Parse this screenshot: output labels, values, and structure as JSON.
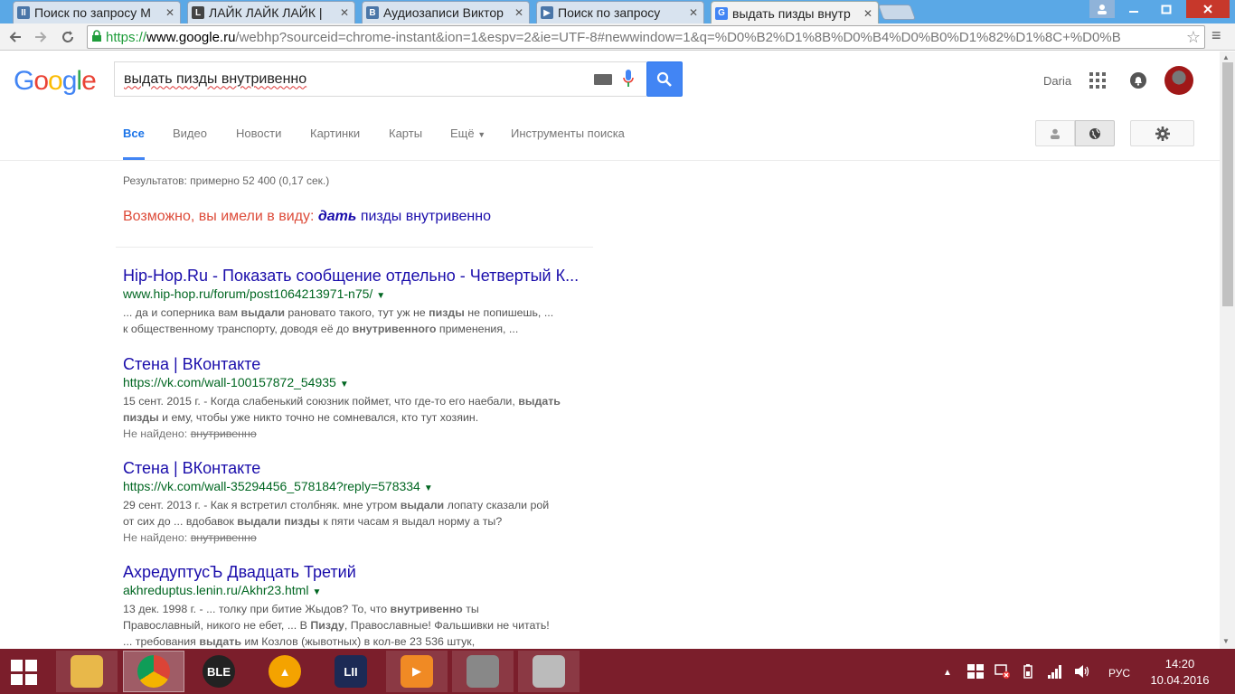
{
  "browser": {
    "tabs": [
      {
        "title": "Поиск по запросу М",
        "fav": "II",
        "fav_color": "#4a76a8"
      },
      {
        "title": "ЛАЙК ЛАЙК ЛАЙК |",
        "fav": "L",
        "fav_color": "#444444"
      },
      {
        "title": "Аудиозаписи Виктор",
        "fav": "B",
        "fav_color": "#4a76a8"
      },
      {
        "title": "Поиск по запросу",
        "fav": "▶",
        "fav_color": "#4a76a8"
      },
      {
        "title": "выдать пизды внутр",
        "fav": "G",
        "fav_color": "#4285f4"
      }
    ],
    "url_scheme": "https://",
    "url_host": "www.google.ru",
    "url_rest": "/webhp?sourceid=chrome-instant&ion=1&espv=2&ie=UTF-8#newwindow=1&q=%D0%B2%D1%8B%D0%B4%D0%B0%D1%82%D1%8C+%D0%B"
  },
  "google": {
    "logo": "Google",
    "query": "выдать пизды внутривенно",
    "user_name": "Daria",
    "nav_tabs": [
      "Все",
      "Видео",
      "Новости",
      "Картинки",
      "Карты",
      "Ещё",
      "Инструменты поиска"
    ],
    "stats": "Результатов: примерно 52 400 (0,17 сек.)",
    "spell_prefix": "Возможно, вы имели в виду:",
    "spell_bold": "дать",
    "spell_rest": "пизды внутривенно"
  },
  "results": [
    {
      "title": "Hip-Hop.Ru - Показать сообщение отдельно - Четвертый К...",
      "url": "www.hip-hop.ru/forum/post1064213971-n75/",
      "snippet_lines": [
        [
          [
            "t",
            "... да и соперника вам "
          ],
          [
            "b",
            "выдали"
          ],
          [
            "t",
            " рановато такого, тут уж не "
          ],
          [
            "b",
            "пизды"
          ],
          [
            "t",
            " не попишешь, ..."
          ]
        ],
        [
          [
            "t",
            "к общественному транспорту, доводя её до "
          ],
          [
            "b",
            "внутривенного"
          ],
          [
            "t",
            " применения, ..."
          ]
        ]
      ],
      "not_found_label": "",
      "not_found_word": ""
    },
    {
      "title": "Стена | ВКонтакте",
      "url": "https://vk.com/wall-100157872_54935",
      "snippet_lines": [
        [
          [
            "t",
            "15 сент. 2015 г. - Когда слабенький союзник поймет, что где-то его наебали, "
          ],
          [
            "b",
            "выдать"
          ]
        ],
        [
          [
            "b",
            "пизды"
          ],
          [
            "t",
            " и ему, чтобы уже никто точно не сомневался, кто тут хозяин."
          ]
        ]
      ],
      "not_found_label": "Не найдено:",
      "not_found_word": "внутривенно"
    },
    {
      "title": "Стена | ВКонтакте",
      "url": "https://vk.com/wall-35294456_578184?reply=578334",
      "snippet_lines": [
        [
          [
            "t",
            "29 сент. 2013 г. - Как я встретил столбняк. мне утром "
          ],
          [
            "b",
            "выдали"
          ],
          [
            "t",
            " лопату сказали рой"
          ]
        ],
        [
          [
            "t",
            "от сих до ... вдобавок "
          ],
          [
            "b",
            "выдали пизды"
          ],
          [
            "t",
            " к пяти часам я выдал норму а ты?"
          ]
        ]
      ],
      "not_found_label": "Не найдено:",
      "not_found_word": "внутривенно"
    },
    {
      "title": "АхредуптусЪ Двадцать Третий",
      "url": "akhreduptus.lenin.ru/Akhr23.html",
      "snippet_lines": [
        [
          [
            "t",
            "13 дек. 1998 г. - ... толку при битие Жыдов? То, что "
          ],
          [
            "b",
            "внутривенно"
          ],
          [
            "t",
            " ты"
          ]
        ],
        [
          [
            "t",
            "Православный, никого не ебет, ... В "
          ],
          [
            "b",
            "Пизду"
          ],
          [
            "t",
            ", Православные! Фальшивки не читать!"
          ]
        ],
        [
          [
            "t",
            "... требования "
          ],
          [
            "b",
            "выдать"
          ],
          [
            "t",
            " им Козлов (жывотных) в кол-ве 23 536 штук,"
          ]
        ]
      ],
      "not_found_label": "",
      "not_found_word": ""
    }
  ],
  "taskbar": {
    "apps": [
      {
        "name": "explorer",
        "glyph": "",
        "color": "#e8b84a"
      },
      {
        "name": "chrome",
        "glyph": "",
        "color": "#dd4b39"
      },
      {
        "name": "ble",
        "glyph": "BLE",
        "color": "#222222"
      },
      {
        "name": "aimp",
        "glyph": "▲",
        "color": "#f4a300"
      },
      {
        "name": "lineage",
        "glyph": "LII",
        "color": "#1c2a55"
      },
      {
        "name": "player",
        "glyph": "▶",
        "color": "#f08a24"
      },
      {
        "name": "app7",
        "glyph": "",
        "color": "#888888"
      },
      {
        "name": "speaker",
        "glyph": "",
        "color": "#bbbbbb"
      }
    ],
    "lang": "РУС",
    "time": "14:20",
    "date": "10.04.2016"
  }
}
